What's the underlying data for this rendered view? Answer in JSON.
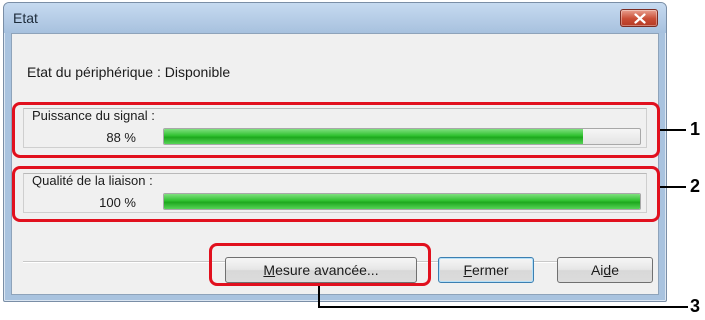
{
  "window": {
    "title": "Etat",
    "device_status": "Etat du périphérique : Disponible"
  },
  "signal": {
    "label": "Puissance du signal :",
    "value_text": "88 %",
    "value_fraction": 0.88
  },
  "link_quality": {
    "label": "Qualité de la liaison :",
    "value_text": "100 %",
    "value_fraction": 1.0
  },
  "buttons": {
    "advanced": {
      "first": "M",
      "rest": "esure avancée..."
    },
    "close": {
      "first": "F",
      "rest": "ermer"
    },
    "help": {
      "pre": "Ai",
      "u": "d",
      "post": "e"
    }
  },
  "callouts": [
    "1",
    "2",
    "3"
  ],
  "colors": {
    "highlight": "#e1101e",
    "progress": "#2fc12f",
    "close_button": "#c94d35"
  },
  "icons": {
    "close": "close-icon"
  }
}
